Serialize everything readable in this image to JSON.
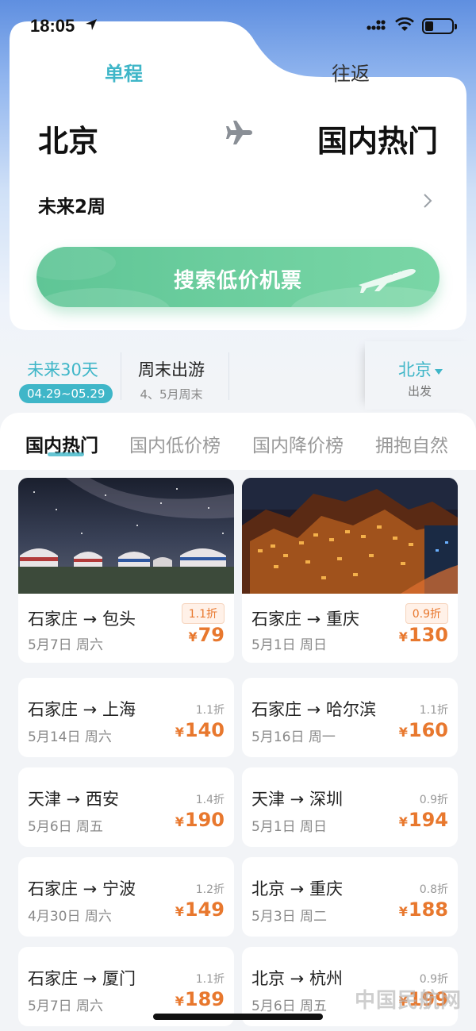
{
  "status_bar": {
    "time": "18:05"
  },
  "search": {
    "tabs": [
      {
        "label": "单程"
      },
      {
        "label": "往返"
      }
    ],
    "from_city": "北京",
    "to_city": "国内热门",
    "date_range": "未来2周",
    "button_label": "搜索低价机票"
  },
  "quick_filters": {
    "next30": {
      "label": "未来30天",
      "range": "04.29~05.29"
    },
    "weekend": {
      "label": "周末出游",
      "sub": "4、5月周末"
    },
    "depart": {
      "city": "北京",
      "sub": "出发"
    }
  },
  "category_tabs": [
    {
      "label": "国内热门"
    },
    {
      "label": "国内低价榜"
    },
    {
      "label": "国内降价榜"
    },
    {
      "label": "拥抱自然"
    }
  ],
  "deals": [
    {
      "route": "石家庄 → 包头",
      "date": "5月7日 周六",
      "discount": "1.1折",
      "price": "79"
    },
    {
      "route": "石家庄 → 重庆",
      "date": "5月1日 周日",
      "discount": "0.9折",
      "price": "130"
    },
    {
      "route": "石家庄 → 上海",
      "date": "5月14日 周六",
      "discount": "1.1折",
      "price": "140"
    },
    {
      "route": "石家庄 → 哈尔滨",
      "date": "5月16日 周一",
      "discount": "1.1折",
      "price": "160"
    },
    {
      "route": "天津 → 西安",
      "date": "5月6日 周五",
      "discount": "1.4折",
      "price": "190"
    },
    {
      "route": "天津 → 深圳",
      "date": "5月1日 周日",
      "discount": "0.9折",
      "price": "194"
    },
    {
      "route": "石家庄 → 宁波",
      "date": "4月30日 周六",
      "discount": "1.2折",
      "price": "149"
    },
    {
      "route": "北京 → 重庆",
      "date": "5月3日 周二",
      "discount": "0.8折",
      "price": "188"
    },
    {
      "route": "石家庄 → 厦门",
      "date": "5月7日 周六",
      "discount": "1.1折",
      "price": "189"
    },
    {
      "route": "北京 → 杭州",
      "date": "5月6日 周五",
      "discount": "0.9折",
      "price": "199"
    }
  ],
  "currency_symbol": "¥",
  "watermark": "中国民航网",
  "colors": {
    "accent": "#3fb6c8",
    "button": "#6fd0a0",
    "price": "#e8782e"
  },
  "icons": [
    "location-arrow-icon",
    "signal-icon",
    "wifi-icon",
    "battery-icon",
    "plane-icon",
    "chevron-right-icon",
    "caret-down-icon"
  ]
}
